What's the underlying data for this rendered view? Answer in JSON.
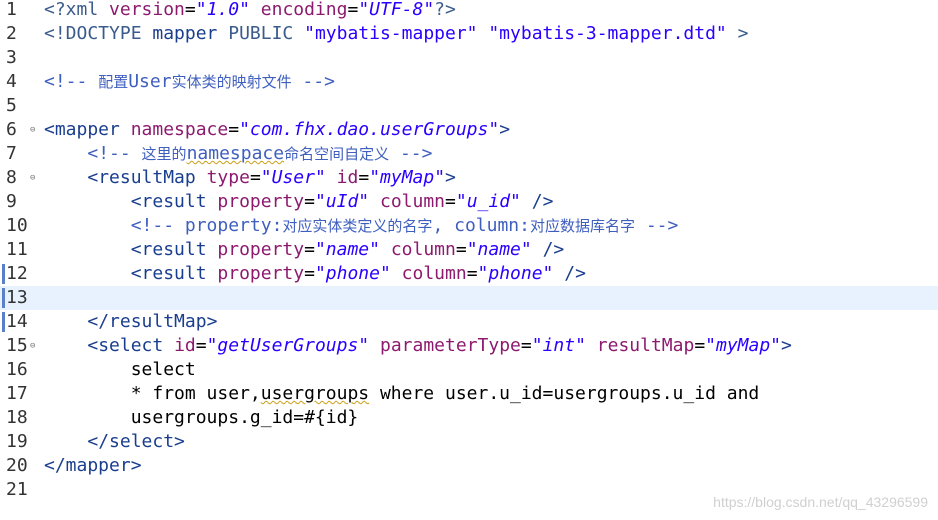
{
  "lines": [
    {
      "n": "1",
      "fold": "",
      "parts": [
        {
          "c": "t-pi",
          "t": "<?xml "
        },
        {
          "c": "t-att",
          "t": "version"
        },
        {
          "c": "t-txt",
          "t": "="
        },
        {
          "c": "t-val",
          "t": "\"1.0\""
        },
        {
          "c": "t-txt",
          "t": " "
        },
        {
          "c": "t-att",
          "t": "encoding"
        },
        {
          "c": "t-txt",
          "t": "="
        },
        {
          "c": "t-val",
          "t": "\"UTF-8\""
        },
        {
          "c": "t-pi",
          "t": "?>"
        }
      ]
    },
    {
      "n": "2",
      "fold": "",
      "parts": [
        {
          "c": "t-dt",
          "t": "<!DOCTYPE "
        },
        {
          "c": "t-tag",
          "t": "mapper"
        },
        {
          "c": "t-dt",
          "t": " PUBLIC "
        },
        {
          "c": "t-dts",
          "t": "\"mybatis-mapper\""
        },
        {
          "c": "t-txt",
          "t": " "
        },
        {
          "c": "t-dts",
          "t": "\"mybatis-3-mapper.dtd\""
        },
        {
          "c": "t-dt",
          "t": " >"
        }
      ]
    },
    {
      "n": "3",
      "fold": "",
      "parts": []
    },
    {
      "n": "4",
      "fold": "",
      "parts": [
        {
          "c": "t-cm",
          "t": "<!-- "
        },
        {
          "c": "t-cmz",
          "t": "配置"
        },
        {
          "c": "t-cm",
          "t": "User"
        },
        {
          "c": "t-cmz",
          "t": "实体类的映射文件"
        },
        {
          "c": "t-cm",
          "t": " -->"
        }
      ]
    },
    {
      "n": "5",
      "fold": "",
      "parts": []
    },
    {
      "n": "6",
      "fold": "⊖",
      "parts": [
        {
          "c": "t-tag",
          "t": "<mapper "
        },
        {
          "c": "t-att",
          "t": "namespace"
        },
        {
          "c": "t-txt",
          "t": "="
        },
        {
          "c": "t-val",
          "t": "\"com.fhx.dao.userGroups\""
        },
        {
          "c": "t-tag",
          "t": ">"
        }
      ]
    },
    {
      "n": "7",
      "fold": "",
      "parts": [
        {
          "c": "t-txt",
          "t": "    "
        },
        {
          "c": "t-cm",
          "t": "<!-- "
        },
        {
          "c": "t-cmz",
          "t": "这里的"
        },
        {
          "c": "t-cm squig",
          "t": "namespace"
        },
        {
          "c": "t-cmz",
          "t": "命名空间自定义"
        },
        {
          "c": "t-cm",
          "t": " -->"
        }
      ]
    },
    {
      "n": "8",
      "fold": "⊖",
      "parts": [
        {
          "c": "t-txt",
          "t": "    "
        },
        {
          "c": "t-tag",
          "t": "<resultMap "
        },
        {
          "c": "t-att",
          "t": "type"
        },
        {
          "c": "t-txt",
          "t": "="
        },
        {
          "c": "t-val",
          "t": "\"User\""
        },
        {
          "c": "t-txt",
          "t": " "
        },
        {
          "c": "t-att",
          "t": "id"
        },
        {
          "c": "t-txt",
          "t": "="
        },
        {
          "c": "t-val",
          "t": "\"myMap\""
        },
        {
          "c": "t-tag",
          "t": ">"
        }
      ]
    },
    {
      "n": "9",
      "fold": "",
      "parts": [
        {
          "c": "t-txt",
          "t": "        "
        },
        {
          "c": "t-tag",
          "t": "<result "
        },
        {
          "c": "t-att",
          "t": "property"
        },
        {
          "c": "t-txt",
          "t": "="
        },
        {
          "c": "t-val",
          "t": "\"uId\""
        },
        {
          "c": "t-txt",
          "t": " "
        },
        {
          "c": "t-att",
          "t": "column"
        },
        {
          "c": "t-txt",
          "t": "="
        },
        {
          "c": "t-val",
          "t": "\"u_id\""
        },
        {
          "c": "t-tag",
          "t": " />"
        }
      ]
    },
    {
      "n": "10",
      "fold": "",
      "parts": [
        {
          "c": "t-txt",
          "t": "        "
        },
        {
          "c": "t-cm",
          "t": "<!-- property:"
        },
        {
          "c": "t-cmz",
          "t": "对应实体类定义的名字"
        },
        {
          "c": "t-cm",
          "t": ", column:"
        },
        {
          "c": "t-cmz",
          "t": "对应数据库名字"
        },
        {
          "c": "t-cm",
          "t": " -->"
        }
      ]
    },
    {
      "n": "11",
      "fold": "",
      "parts": [
        {
          "c": "t-txt",
          "t": "        "
        },
        {
          "c": "t-tag",
          "t": "<result "
        },
        {
          "c": "t-att",
          "t": "property"
        },
        {
          "c": "t-txt",
          "t": "="
        },
        {
          "c": "t-val",
          "t": "\"name\""
        },
        {
          "c": "t-txt",
          "t": " "
        },
        {
          "c": "t-att",
          "t": "column"
        },
        {
          "c": "t-txt",
          "t": "="
        },
        {
          "c": "t-val",
          "t": "\"name\""
        },
        {
          "c": "t-tag",
          "t": " />"
        }
      ]
    },
    {
      "n": "12",
      "fold": "",
      "parts": [
        {
          "c": "t-txt",
          "t": "        "
        },
        {
          "c": "t-tag",
          "t": "<result "
        },
        {
          "c": "t-att",
          "t": "property"
        },
        {
          "c": "t-txt",
          "t": "="
        },
        {
          "c": "t-val",
          "t": "\"phone\""
        },
        {
          "c": "t-txt",
          "t": " "
        },
        {
          "c": "t-att",
          "t": "column"
        },
        {
          "c": "t-txt",
          "t": "="
        },
        {
          "c": "t-val",
          "t": "\"phone\""
        },
        {
          "c": "t-tag",
          "t": " />"
        }
      ]
    },
    {
      "n": "13",
      "fold": "",
      "parts": []
    },
    {
      "n": "14",
      "fold": "",
      "parts": [
        {
          "c": "t-txt",
          "t": "    "
        },
        {
          "c": "t-tag",
          "t": "</resultMap>"
        }
      ]
    },
    {
      "n": "15",
      "fold": "⊖",
      "parts": [
        {
          "c": "t-txt",
          "t": "    "
        },
        {
          "c": "t-tag",
          "t": "<select "
        },
        {
          "c": "t-att",
          "t": "id"
        },
        {
          "c": "t-txt",
          "t": "="
        },
        {
          "c": "t-val",
          "t": "\"getUserGroups\""
        },
        {
          "c": "t-txt",
          "t": " "
        },
        {
          "c": "t-att",
          "t": "parameterType"
        },
        {
          "c": "t-txt",
          "t": "="
        },
        {
          "c": "t-val",
          "t": "\"int\""
        },
        {
          "c": "t-txt",
          "t": " "
        },
        {
          "c": "t-att",
          "t": "resultMap"
        },
        {
          "c": "t-txt",
          "t": "="
        },
        {
          "c": "t-val",
          "t": "\"myMap\""
        },
        {
          "c": "t-tag",
          "t": ">"
        }
      ]
    },
    {
      "n": "16",
      "fold": "",
      "parts": [
        {
          "c": "t-txt",
          "t": "        select"
        }
      ]
    },
    {
      "n": "17",
      "fold": "",
      "parts": [
        {
          "c": "t-txt",
          "t": "        * from user,"
        },
        {
          "c": "t-txt squig",
          "t": "usergroups"
        },
        {
          "c": "t-txt",
          "t": " where user.u_id=usergroups.u_id and"
        }
      ]
    },
    {
      "n": "18",
      "fold": "",
      "parts": [
        {
          "c": "t-txt",
          "t": "        usergroups.g_id=#{id}"
        }
      ]
    },
    {
      "n": "19",
      "fold": "",
      "parts": [
        {
          "c": "t-txt",
          "t": "    "
        },
        {
          "c": "t-tag",
          "t": "</select>"
        }
      ]
    },
    {
      "n": "20",
      "fold": "",
      "parts": [
        {
          "c": "t-tag",
          "t": "</mapper>"
        }
      ]
    },
    {
      "n": "21",
      "fold": "",
      "parts": []
    }
  ],
  "current_line": "13",
  "marked_lines": [
    "12",
    "13",
    "14"
  ],
  "watermark": "https://blog.csdn.net/qq_43296599"
}
